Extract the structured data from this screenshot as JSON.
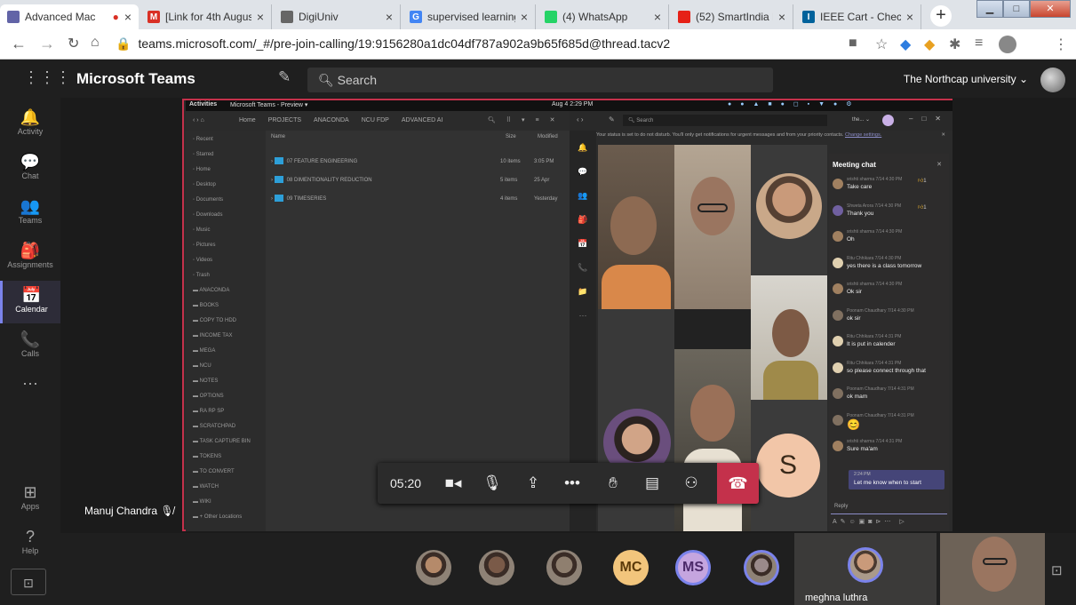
{
  "browser": {
    "tabs": [
      {
        "title": "Advanced Mac",
        "color": "#6264a7",
        "active": true,
        "recording": true
      },
      {
        "title": "[Link for 4th August",
        "color": "#d93025",
        "favtext": "M"
      },
      {
        "title": "DigiUniv",
        "color": "#666"
      },
      {
        "title": "supervised learning",
        "color": "#4285f4",
        "favtext": "G"
      },
      {
        "title": "(4) WhatsApp",
        "color": "#25d366"
      },
      {
        "title": "(52) SmartIndia Ha",
        "color": "#e62117"
      },
      {
        "title": "IEEE Cart - Checkou",
        "color": "#00629b",
        "favtext": "IEEE"
      }
    ],
    "url": "teams.microsoft.com/_#/pre-join-calling/19:9156280a1dc04df787a902a9b65f685d@thread.tacv2"
  },
  "teams": {
    "app_name": "Microsoft Teams",
    "search_placeholder": "Search",
    "org": "The Northcap university",
    "rail": [
      {
        "label": "Activity",
        "icon": "bell-icon",
        "glyph": "🔔"
      },
      {
        "label": "Chat",
        "icon": "chat-icon",
        "glyph": "💬"
      },
      {
        "label": "Teams",
        "icon": "teams-icon",
        "glyph": "👥"
      },
      {
        "label": "Assignments",
        "icon": "assignments-icon",
        "glyph": "🎒"
      },
      {
        "label": "Calendar",
        "icon": "calendar-icon",
        "glyph": "📅",
        "selected": true
      },
      {
        "label": "Calls",
        "icon": "phone-icon",
        "glyph": "📞"
      },
      {
        "label": "...",
        "icon": "more-icon",
        "glyph": "⋯"
      }
    ],
    "rail_bottom": [
      {
        "label": "Apps",
        "icon": "apps-icon",
        "glyph": "⊞"
      },
      {
        "label": "Help",
        "icon": "help-icon",
        "glyph": "?"
      }
    ]
  },
  "shared_screen": {
    "topbar_left": "Activities",
    "topbar_app": "Microsoft Teams - Preview ▾",
    "topbar_time": "Aug 4  2:29 PM",
    "files_breadcrumb": [
      "Home",
      "PROJECTS",
      "ANACONDA",
      "NCU FDP",
      "ADVANCED AI"
    ],
    "files_headers": {
      "name": "Name",
      "size": "Size",
      "modified": "Modified"
    },
    "files_sidebar": [
      "Recent",
      "Starred",
      "Home",
      "Desktop",
      "Documents",
      "Downloads",
      "Music",
      "Pictures",
      "Videos",
      "Trash",
      "ANACONDA",
      "BOOKS",
      "COPY TO HDD",
      "INCOME TAX",
      "MEGA",
      "NCU",
      "NOTES",
      "OPTIONS",
      "RA RP SP",
      "SCRATCHPAD",
      "TASK CAPTURE BIN",
      "TOKENS",
      "TO CONVERT",
      "WATCH",
      "WIKI",
      "+ Other Locations"
    ],
    "files_rows": [
      {
        "name": "07 FEATURE ENGINEERING",
        "size": "10 items",
        "modified": "3:05 PM"
      },
      {
        "name": "08 DIMENTIONALITY REDUCTION",
        "size": "5 items",
        "modified": "25 Apr"
      },
      {
        "name": "09 TIMESERIES",
        "size": "4 items",
        "modified": "Yesterday"
      }
    ],
    "inner_search": "Search",
    "status_banner": "Your status is set to do not disturb. You'll only get notifications for urgent messages and from your priority contacts.",
    "status_link": "Change settings.",
    "tile_letter": "S",
    "chat_title": "Meeting chat",
    "chat": [
      {
        "meta": "srishti sharma  7/14 4:30 PM",
        "text": "Take care",
        "like": "1"
      },
      {
        "meta": "Shweta Arora  7/14 4:30 PM",
        "text": "Thank you",
        "like": "1"
      },
      {
        "meta": "srishti sharma  7/14 4:30 PM",
        "text": "Oh"
      },
      {
        "meta": "Ritu Chhikara  7/14 4:30 PM",
        "text": "yes there is a class tomorrow"
      },
      {
        "meta": "srishti sharma  7/14 4:30 PM",
        "text": "Ok sir"
      },
      {
        "meta": "Poonam Chaudhary  7/14 4:30 PM",
        "text": "ok sir"
      },
      {
        "meta": "Ritu Chhikara  7/14 4:31 PM",
        "text": "It is put in calender"
      },
      {
        "meta": "Ritu Chhikara  7/14 4:31 PM",
        "text": "so please connect through that"
      },
      {
        "meta": "Poonam Chaudhary  7/14 4:31 PM",
        "text": "ok mam"
      },
      {
        "meta": "Poonam Chaudhary  7/14 4:31 PM",
        "text": "😊"
      },
      {
        "meta": "srishti sharma  7/14 4:31 PM",
        "text": "Sure ma'am"
      }
    ],
    "chat_own": {
      "meta": "2:24 PM",
      "text": "Let me know when to start"
    },
    "reply": "Reply"
  },
  "call": {
    "timer": "05:20",
    "presenter": "Manuj Chandra",
    "participants": [
      {
        "type": "photo",
        "color": "#b58a6a"
      },
      {
        "type": "photo",
        "color": "#7a5a48"
      },
      {
        "type": "photo",
        "color": "#8f7f6f"
      },
      {
        "type": "initials",
        "text": "MC",
        "bg": "#f2c57c",
        "fg": "#5b3a0a"
      },
      {
        "type": "initials",
        "text": "MS",
        "bg": "#c5a5df",
        "fg": "#4c2a6a",
        "ring": true
      },
      {
        "type": "photo",
        "color": "#9a8a8a",
        "ring": true
      }
    ],
    "active_speaker": "meghna luthra"
  }
}
